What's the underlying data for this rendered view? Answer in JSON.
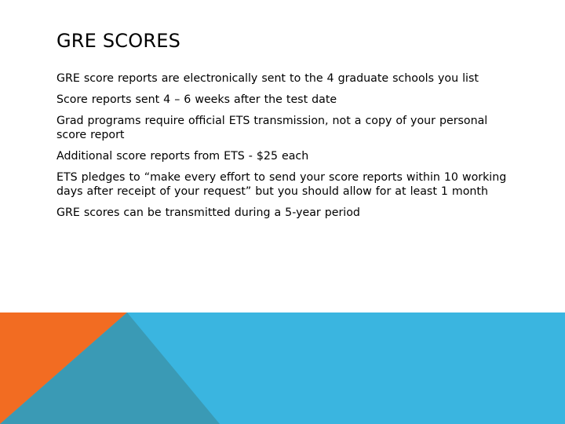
{
  "slide": {
    "title": "GRE SCORES",
    "bullets": [
      "GRE score reports are electronically sent to the 4 graduate schools you list",
      "Score reports sent 4 – 6 weeks after the test date",
      "Grad programs require official ETS transmission, not a copy of your personal score report",
      "Additional score reports from ETS - $25 each",
      "ETS pledges to “make every effort to send your score reports within 10 working days after receipt of your request” but you should allow for at least 1 month",
      "GRE scores can be transmitted during a 5-year period"
    ]
  },
  "theme": {
    "blue": "#3AB5E0",
    "teal": "#3A9AB5",
    "orange": "#F26C22"
  }
}
